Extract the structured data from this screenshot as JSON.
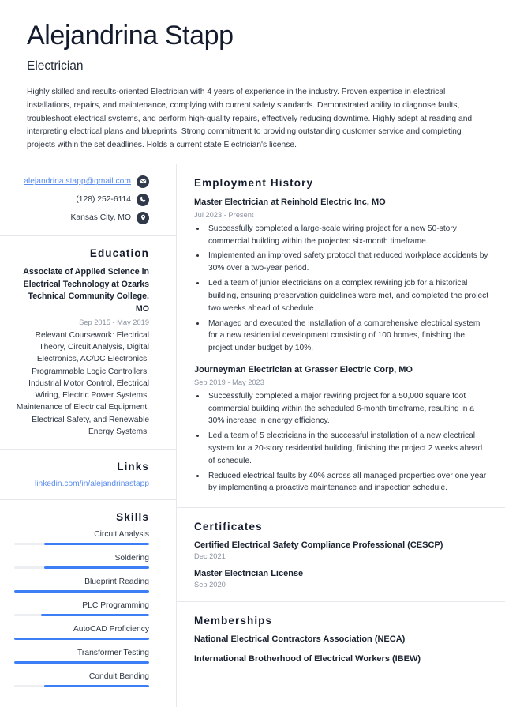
{
  "header": {
    "name": "Alejandrina Stapp",
    "job_title": "Electrician",
    "summary": "Highly skilled and results-oriented Electrician with 4 years of experience in the industry. Proven expertise in electrical installations, repairs, and maintenance, complying with current safety standards. Demonstrated ability to diagnose faults, troubleshoot electrical systems, and perform high-quality repairs, effectively reducing downtime. Highly adept at reading and interpreting electrical plans and blueprints. Strong commitment to providing outstanding customer service and completing projects within the set deadlines. Holds a current state Electrician's license."
  },
  "contact": {
    "email": "alejandrina.stapp@gmail.com",
    "phone": "(128) 252-6114",
    "location": "Kansas City, MO",
    "email_icon": "envelope-icon",
    "phone_icon": "phone-icon",
    "location_icon": "map-pin-icon"
  },
  "education": {
    "heading": "Education",
    "degree": "Associate of Applied Science in Electrical Technology at Ozarks Technical Community College, MO",
    "date": "Sep 2015 - May 2019",
    "description": "Relevant Coursework: Electrical Theory, Circuit Analysis, Digital Electronics, AC/DC Electronics, Programmable Logic Controllers, Industrial Motor Control, Electrical Wiring, Electric Power Systems, Maintenance of Electrical Equipment, Electrical Safety, and Renewable Energy Systems."
  },
  "links": {
    "heading": "Links",
    "items": [
      {
        "label": "linkedin.com/in/alejandrinastapp"
      }
    ]
  },
  "skills": {
    "heading": "Skills",
    "items": [
      {
        "label": "Circuit Analysis",
        "level": 78
      },
      {
        "label": "Soldering",
        "level": 78
      },
      {
        "label": "Blueprint Reading",
        "level": 100
      },
      {
        "label": "PLC Programming",
        "level": 80
      },
      {
        "label": "AutoCAD Proficiency",
        "level": 100
      },
      {
        "label": "Transformer Testing",
        "level": 100
      },
      {
        "label": "Conduit Bending",
        "level": 78
      }
    ]
  },
  "employment": {
    "heading": "Employment History",
    "entries": [
      {
        "title": "Master Electrician at Reinhold Electric Inc, MO",
        "date": "Jul 2023 - Present",
        "bullets": [
          "Successfully completed a large-scale wiring project for a new 50-story commercial building within the projected six-month timeframe.",
          "Implemented an improved safety protocol that reduced workplace accidents by 30% over a two-year period.",
          "Led a team of junior electricians on a complex rewiring job for a historical building, ensuring preservation guidelines were met, and completed the project two weeks ahead of schedule.",
          "Managed and executed the installation of a comprehensive electrical system for a new residential development consisting of 100 homes, finishing the project under budget by 10%."
        ]
      },
      {
        "title": "Journeyman Electrician at Grasser Electric Corp, MO",
        "date": "Sep 2019 - May 2023",
        "bullets": [
          "Successfully completed a major rewiring project for a 50,000 square foot commercial building within the scheduled 6-month timeframe, resulting in a 30% increase in energy efficiency.",
          "Led a team of 5 electricians in the successful installation of a new electrical system for a 20-story residential building, finishing the project 2 weeks ahead of schedule.",
          "Reduced electrical faults by 40% across all managed properties over one year by implementing a proactive maintenance and inspection schedule."
        ]
      }
    ]
  },
  "certificates": {
    "heading": "Certificates",
    "items": [
      {
        "name": "Certified Electrical Safety Compliance Professional (CESCP)",
        "date": "Dec 2021"
      },
      {
        "name": "Master Electrician License",
        "date": "Sep 2020"
      }
    ]
  },
  "memberships": {
    "heading": "Memberships",
    "items": [
      {
        "name": "National Electrical Contractors Association (NECA)"
      },
      {
        "name": "International Brotherhood of Electrical Workers (IBEW)"
      }
    ]
  },
  "colors": {
    "accent": "#3b7ef5",
    "link": "#5b8def",
    "heading": "#141b2d",
    "muted": "#8b93a1",
    "icon_bg": "#2f3949",
    "divider": "#e6e8ec"
  }
}
